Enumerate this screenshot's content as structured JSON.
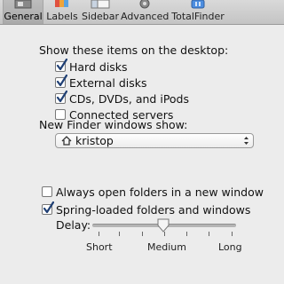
{
  "toolbar": {
    "tabs": [
      {
        "label": "General",
        "icon": "switch-icon",
        "active": true
      },
      {
        "label": "Labels",
        "icon": "label-tag-icon",
        "active": false
      },
      {
        "label": "Sidebar",
        "icon": "sidebar-icon",
        "active": false
      },
      {
        "label": "Advanced",
        "icon": "gear-icon",
        "active": false
      },
      {
        "label": "TotalFinder",
        "icon": "totalfinder-icon",
        "active": false
      }
    ]
  },
  "desktop": {
    "heading": "Show these items on the desktop:",
    "items": [
      {
        "label": "Hard disks",
        "checked": true
      },
      {
        "label": "External disks",
        "checked": true
      },
      {
        "label": "CDs, DVDs, and iPods",
        "checked": true
      },
      {
        "label": "Connected servers",
        "checked": false
      }
    ]
  },
  "new_window": {
    "heading": "New Finder windows show:",
    "selected": "kristop",
    "selected_icon": "home-icon"
  },
  "always_open": {
    "label": "Always open folders in a new window",
    "checked": false
  },
  "spring_loaded": {
    "label": "Spring-loaded folders and windows",
    "checked": true
  },
  "delay": {
    "label": "Delay:",
    "ticks": [
      "Short",
      "Medium",
      "Long"
    ],
    "value": 0.5
  },
  "colors": {
    "checkbox_blue": "#3c7fd6",
    "background": "#ececec"
  }
}
